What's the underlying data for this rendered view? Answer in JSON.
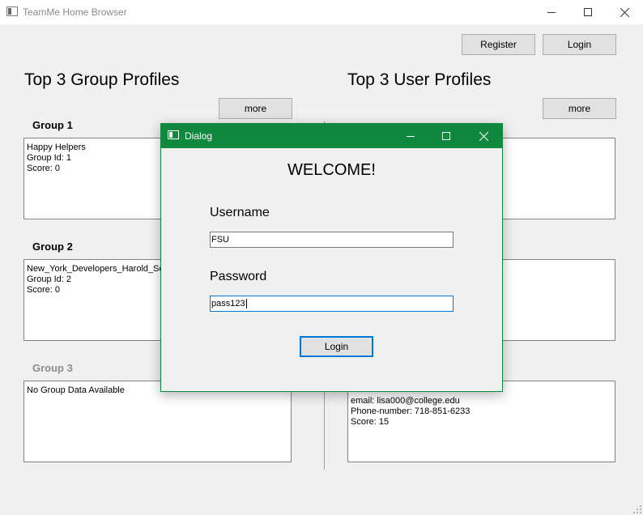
{
  "window": {
    "title": "TeamMe Home Browser"
  },
  "header": {
    "register_label": "Register",
    "login_label": "Login"
  },
  "groups_section": {
    "title": "Top 3 Group Profiles",
    "more_label": "more",
    "groups": [
      {
        "label": "Group 1",
        "details": "Happy Helpers\nGroup Id: 1\nScore: 0"
      },
      {
        "label": "Group 2",
        "details": "New_York_Developers_Harold_Squ\nGroup Id: 2\nScore: 0"
      },
      {
        "label": "Group 3",
        "details": "No Group Data Available"
      }
    ]
  },
  "users_section": {
    "title": "Top 3 User Profiles",
    "more_label": "more",
    "users": [
      {
        "details": ""
      },
      {
        "details": ""
      },
      {
        "details": "email: lisa000@college.edu\nPhone-number: 718-851-6233\nScore: 15"
      }
    ]
  },
  "dialog": {
    "title": "Dialog",
    "welcome": "WELCOME!",
    "username_label": "Username",
    "username_value": "FSU",
    "password_label": "Password",
    "password_value": "pass123",
    "login_label": "Login"
  }
}
